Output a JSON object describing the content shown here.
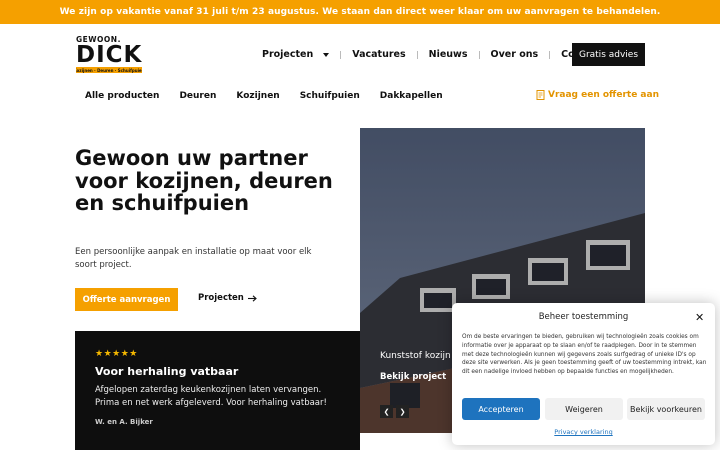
{
  "banner": {
    "text": "We zijn op vakantie vanaf 31 juli t/m 23 augustus. We staan dan direct weer klaar om uw aanvragen te behandelen."
  },
  "logo": {
    "top": "GEWOON.",
    "name": "DICK",
    "tagline": "Kozijnen · Deuren · Schuifpuien"
  },
  "mainnav": {
    "items": [
      "Projecten",
      "Vacatures",
      "Nieuws",
      "Over ons",
      "Contact"
    ],
    "cta": "Gratis advies"
  },
  "subnav": {
    "items": [
      "Alle producten",
      "Deuren",
      "Kozijnen",
      "Schuifpuien",
      "Dakkapellen"
    ],
    "quote": "Vraag een offerte aan"
  },
  "hero": {
    "title": "Gewoon uw partner voor kozijnen, deuren en schuifpuien",
    "subtitle": "Een persoonlijke aanpak en installatie op maat voor elk soort project.",
    "primary_button": "Offerte aanvragen",
    "secondary_link": "Projecten"
  },
  "review": {
    "stars": "★★★★★",
    "title": "Voor herhaling vatbaar",
    "text": "Afgelopen zaterdag keukenkozijnen laten vervangen. Prima en net werk afgeleverd. Voor herhaling vatbaar!",
    "author": "W. en A. Bijker"
  },
  "slider": {
    "caption": "Kunststof kozijn",
    "link": "Bekijk project"
  },
  "consent": {
    "title": "Beheer toestemming",
    "text": "Om de beste ervaringen te bieden, gebruiken wij technologieën zoals cookies om informatie over je apparaat op te slaan en/of te raadplegen. Door in te stemmen met deze technologieën kunnen wij gegevens zoals surfgedrag of unieke ID's op deze site verwerken. Als je geen toestemming geeft of uw toestemming intrekt, kan dit een nadelige invloed hebben op bepaalde functies en mogelijkheden.",
    "accept": "Accepteren",
    "deny": "Weigeren",
    "preferences": "Bekijk voorkeuren",
    "privacy": "Privacy verklaring"
  },
  "colors": {
    "accent": "#f5a000",
    "dark": "#111111",
    "consent_blue": "#1e73be"
  }
}
